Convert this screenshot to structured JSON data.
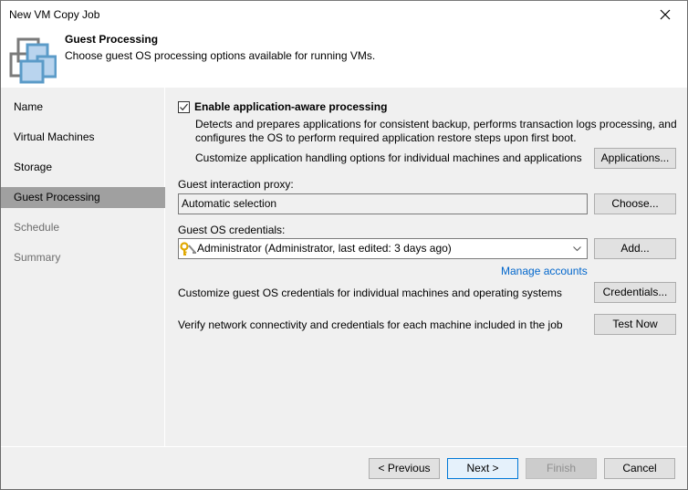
{
  "window": {
    "title": "New VM Copy Job",
    "close_icon": "close-icon"
  },
  "header": {
    "icon": "vm-copy-icon",
    "title": "Guest Processing",
    "subtitle": "Choose guest OS processing options available for running VMs."
  },
  "sidebar": {
    "items": [
      {
        "label": "Name",
        "state": "normal"
      },
      {
        "label": "Virtual Machines",
        "state": "normal"
      },
      {
        "label": "Storage",
        "state": "normal"
      },
      {
        "label": "Guest Processing",
        "state": "active"
      },
      {
        "label": "Schedule",
        "state": "disabled"
      },
      {
        "label": "Summary",
        "state": "disabled"
      }
    ]
  },
  "main": {
    "app_aware": {
      "checkbox_label": "Enable application-aware processing",
      "checked": true,
      "description_line1": "Detects and prepares applications for consistent backup, performs transaction logs processing, and",
      "description_line2": "configures the OS to perform required application restore steps upon first boot.",
      "customize_text": "Customize application handling options for individual machines and applications",
      "applications_button": "Applications..."
    },
    "proxy": {
      "label": "Guest interaction proxy:",
      "value": "Automatic selection",
      "choose_button": "Choose..."
    },
    "credentials": {
      "label": "Guest OS credentials:",
      "icon": "key-icon",
      "selected": "Administrator (Administrator, last edited: 3 days ago)",
      "add_button": "Add...",
      "manage_link": "Manage accounts",
      "customize_text": "Customize guest OS credentials for individual machines and operating systems",
      "credentials_button": "Credentials...",
      "verify_text": "Verify network connectivity and credentials for each machine included in the job",
      "test_button": "Test Now"
    }
  },
  "footer": {
    "previous": "< Previous",
    "next": "Next >",
    "finish": "Finish",
    "cancel": "Cancel"
  },
  "colors": {
    "accent": "#0078d7",
    "link": "#0066cc",
    "active_nav": "#a0a0a0",
    "panel": "#f0f0f0"
  }
}
